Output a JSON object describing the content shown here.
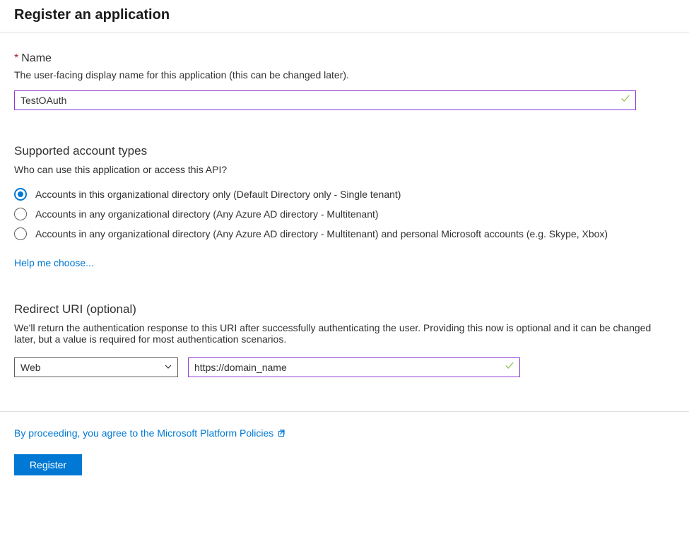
{
  "header": {
    "title": "Register an application"
  },
  "name_section": {
    "required_mark": "*",
    "label": "Name",
    "description": "The user-facing display name for this application (this can be changed later).",
    "value": "TestOAuth"
  },
  "account_types_section": {
    "title": "Supported account types",
    "subtitle": "Who can use this application or access this API?",
    "options": [
      {
        "label": "Accounts in this organizational directory only (Default Directory only - Single tenant)",
        "selected": true
      },
      {
        "label": "Accounts in any organizational directory (Any Azure AD directory - Multitenant)",
        "selected": false
      },
      {
        "label": "Accounts in any organizational directory (Any Azure AD directory - Multitenant) and personal Microsoft accounts (e.g. Skype, Xbox)",
        "selected": false
      }
    ],
    "help_link": "Help me choose..."
  },
  "redirect_section": {
    "title": "Redirect URI (optional)",
    "description": "We'll return the authentication response to this URI after successfully authenticating the user. Providing this now is optional and it can be changed later, but a value is required for most authentication scenarios.",
    "platform_selected": "Web",
    "uri_value": "https://domain_name"
  },
  "footer": {
    "policy_text": "By proceeding, you agree to the Microsoft Platform Policies",
    "register_label": "Register"
  },
  "colors": {
    "link": "#0078d4",
    "primary_button": "#0078d4",
    "validated_border": "#8e3bd6",
    "check_green": "#92c353"
  }
}
